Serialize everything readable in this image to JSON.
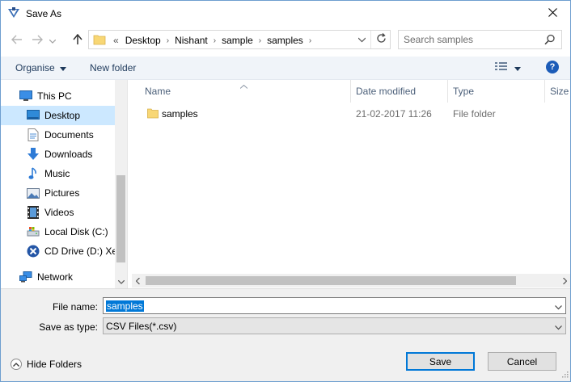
{
  "window": {
    "title": "Save As",
    "close_glyph": "✕"
  },
  "address_bar": {
    "overflow_glyph": "«",
    "crumbs": [
      "Desktop",
      "Nishant",
      "sample",
      "samples"
    ],
    "separator_glyph": "›"
  },
  "search": {
    "placeholder": "Search samples"
  },
  "toolbar": {
    "organise_label": "Organise",
    "new_folder_label": "New folder",
    "help_glyph": "?"
  },
  "nav_pane": {
    "items": [
      {
        "label": "This PC",
        "icon": "computer-icon"
      },
      {
        "label": "Desktop",
        "icon": "desktop-icon",
        "selected": true
      },
      {
        "label": "Documents",
        "icon": "documents-icon"
      },
      {
        "label": "Downloads",
        "icon": "downloads-icon"
      },
      {
        "label": "Music",
        "icon": "music-icon"
      },
      {
        "label": "Pictures",
        "icon": "pictures-icon"
      },
      {
        "label": "Videos",
        "icon": "videos-icon"
      },
      {
        "label": "Local Disk (C:)",
        "icon": "local-disk-icon"
      },
      {
        "label": "CD Drive (D:) Xer",
        "icon": "cd-drive-icon"
      },
      {
        "label": "Network",
        "icon": "network-icon"
      }
    ]
  },
  "file_list": {
    "columns": [
      "Name",
      "Date modified",
      "Type",
      "Size"
    ],
    "rows": [
      {
        "name": "samples",
        "date_modified": "21-02-2017 11:26",
        "type": "File folder",
        "size": ""
      }
    ]
  },
  "save_panel": {
    "file_name_label": "File name:",
    "file_name_value": "samples",
    "save_as_type_label": "Save as type:",
    "save_as_type_value": "CSV Files(*.csv)",
    "hide_folders_label": "Hide Folders",
    "save_label": "Save",
    "cancel_label": "Cancel"
  },
  "colors": {
    "accent": "#0078d7",
    "selection": "#cce8ff",
    "folder_yellow": "#f8d775",
    "toolbar_bg": "#f0f4f9",
    "panel_bg": "#f0f0f0"
  }
}
